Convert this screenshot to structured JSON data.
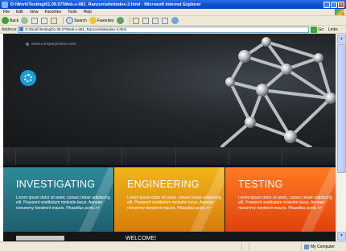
{
  "window": {
    "title": "D:\\Work\\Testing\\01.09.07\\Web-x-081_Ranzon\\site\\index-3.html - Microsoft Internet Explorer",
    "minimize": "_",
    "maximize": "□",
    "close": "×"
  },
  "menu": [
    "File",
    "Edit",
    "View",
    "Favorites",
    "Tools",
    "Help"
  ],
  "toolbar": {
    "back_label": "Back",
    "search_label": "Search",
    "favorites_label": "Favorites"
  },
  "address": {
    "label": "Address",
    "value": "D:\\Work\\Testing\\01.09.07\\Web-x-081_Ranzon\\site\\index-3.html",
    "go_label": "Go",
    "links_label": "Links"
  },
  "site": {
    "url_text": "www.companyname.com",
    "panels": [
      {
        "title": "INVESTIGATING",
        "body": "Lorem ipsum dolor sit amet, consec tetuer adipiscing elit. Praesent vestibulum molestie lacus. Aenean nonummy hendrerit mauris. Phasellus porta >>",
        "color": "#2d8a9a"
      },
      {
        "title": "ENGINEERING",
        "body": "Lorem ipsum dolor sit amet, consec tetuer adipiscing elit. Praesent vestibulum molestie lacus. Aenean nonummy hendrerit mauris. Phasellus porta >>",
        "color": "#f2b417"
      },
      {
        "title": "TESTING",
        "body": "Lorem ipsum dolor sit amet, consec tetuer adipiscing elit. Praesent vestibulum molestie lacus. Aenean nonummy hendrerit mauris. Phasellus porta >>",
        "color": "#ff7a22"
      }
    ],
    "lower_heading": "WELCOME!"
  },
  "status": {
    "zone_label": "My Computer"
  }
}
